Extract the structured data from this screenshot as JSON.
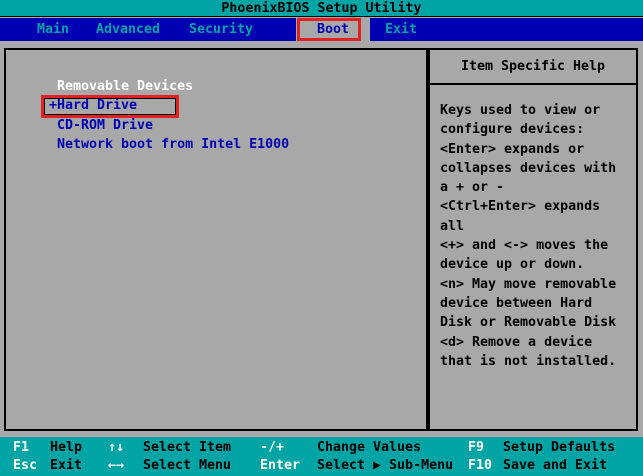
{
  "colors": {
    "teal_bar": "#00a4a4",
    "menu_blue": "#0000b2",
    "panel_gray": "#a8a8a8",
    "annotation_red": "#e02222",
    "item_blue": "#0000b2",
    "item_white": "#ffffff",
    "text_black": "#000000"
  },
  "title_bar": {
    "title": "PhoenixBIOS Setup Utility"
  },
  "menu": {
    "items": [
      {
        "label": "Main",
        "selected": false
      },
      {
        "label": "Advanced",
        "selected": false
      },
      {
        "label": "Security",
        "selected": false
      },
      {
        "label": "Boot",
        "selected": true
      },
      {
        "label": "Exit",
        "selected": false
      }
    ]
  },
  "boot_menu": {
    "items": [
      {
        "label": "Removable Devices",
        "expandable": false,
        "annotated": false
      },
      {
        "label": "+Hard Drive",
        "expandable": true,
        "annotated": true
      },
      {
        "label": "CD-ROM Drive",
        "expandable": false,
        "annotated": false
      },
      {
        "label": "Network boot from Intel E1000",
        "expandable": false,
        "annotated": false
      }
    ]
  },
  "help_panel": {
    "title": "Item Specific Help",
    "lines": [
      "Keys used to view or",
      "configure devices:",
      "<Enter> expands or",
      "collapses devices with",
      "a + or -",
      "<Ctrl+Enter> expands",
      "all",
      "<+> and <-> moves the",
      "device up or down.",
      "<n> May move removable",
      "device between Hard",
      "Disk or Removable Disk",
      "<d> Remove a device",
      "that is not installed."
    ]
  },
  "footer": {
    "hints": [
      {
        "key": "F1",
        "label": "Help"
      },
      {
        "key": "↑↓",
        "label": "Select Item"
      },
      {
        "key": "-/+",
        "label": "Change Values"
      },
      {
        "key": "F9",
        "label": "Setup Defaults"
      },
      {
        "key": "Esc",
        "label": "Exit"
      },
      {
        "key": "←→",
        "label": "Select Menu"
      },
      {
        "key": "Enter",
        "label": "Select ▶ Sub-Menu"
      },
      {
        "key": "F10",
        "label": "Save and Exit"
      }
    ]
  }
}
